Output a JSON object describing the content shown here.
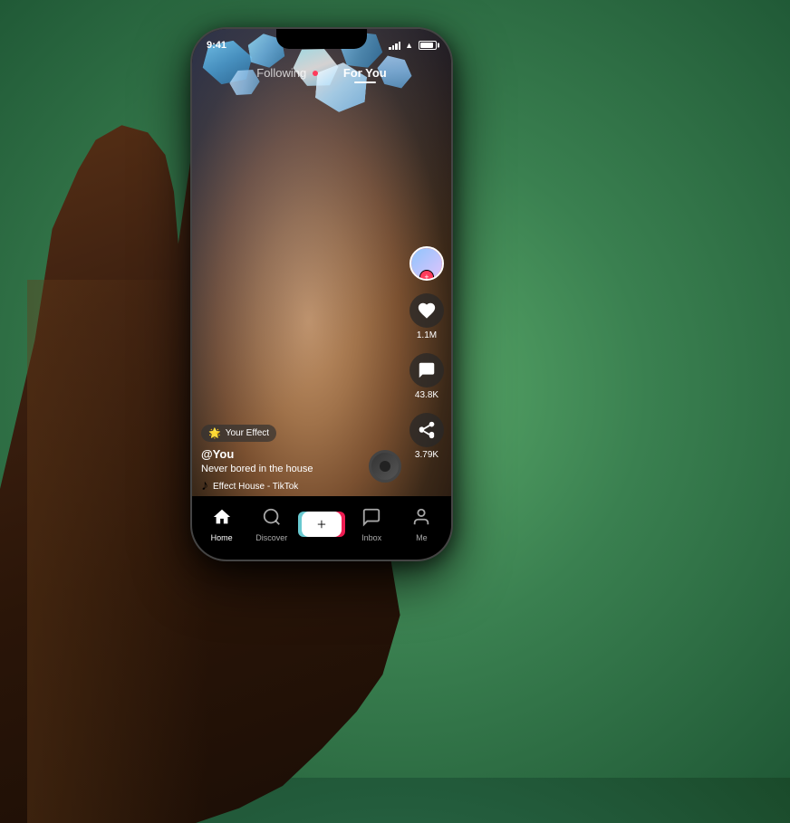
{
  "phone": {
    "statusBar": {
      "time": "9:41",
      "signalBars": [
        3,
        5,
        7,
        9
      ],
      "wifi": true,
      "batteryPercent": 75
    },
    "topNav": {
      "tabs": [
        {
          "id": "following",
          "label": "Following",
          "active": false
        },
        {
          "id": "for-you",
          "label": "For You",
          "active": true
        }
      ],
      "liveDot": true
    },
    "sideActions": [
      {
        "type": "avatar",
        "hasPlus": true,
        "label": ""
      },
      {
        "type": "heart",
        "count": "1.1M",
        "label": "1.1M"
      },
      {
        "type": "comment",
        "count": "43.8K",
        "label": "43.8K"
      },
      {
        "type": "share",
        "count": "3.79K",
        "label": "3.79K"
      }
    ],
    "videoInfo": {
      "effectBadge": "🌟 Your Effect",
      "username": "@You",
      "caption": "Never bored in the house",
      "music": "♪  Effect House - TikTok"
    },
    "bottomNav": [
      {
        "id": "home",
        "label": "Home",
        "icon": "🏠",
        "active": true
      },
      {
        "id": "discover",
        "label": "Discover",
        "icon": "🔍",
        "active": false
      },
      {
        "id": "create",
        "label": "",
        "icon": "+",
        "active": false,
        "isPlus": true
      },
      {
        "id": "inbox",
        "label": "Inbox",
        "icon": "💬",
        "active": false
      },
      {
        "id": "me",
        "label": "Me",
        "icon": "👤",
        "active": false
      }
    ]
  }
}
